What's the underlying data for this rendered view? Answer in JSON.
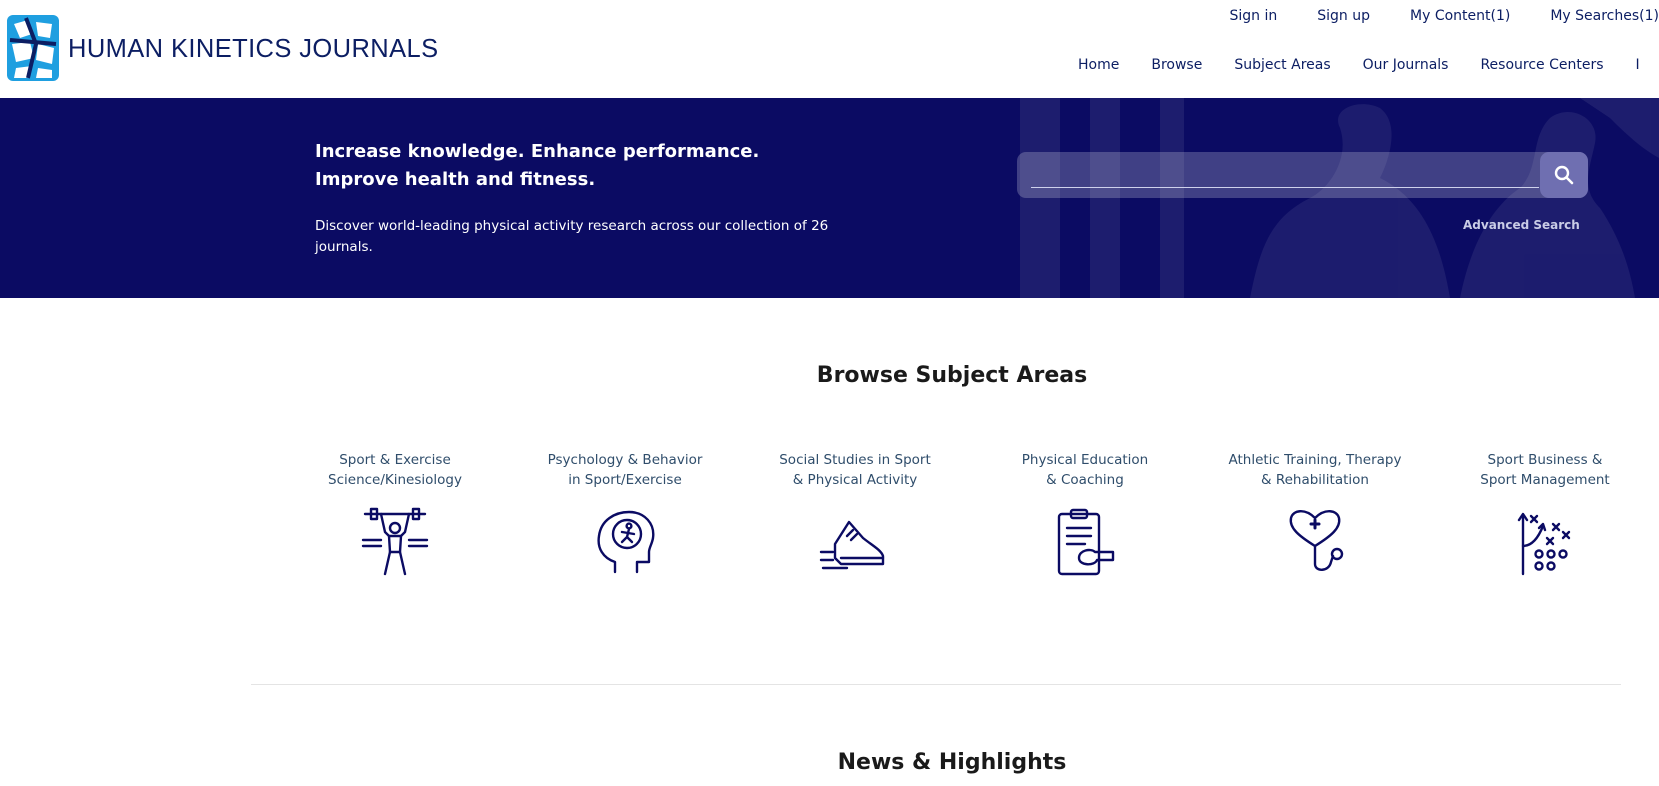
{
  "brand": {
    "name": "HUMAN KINETICS JOURNALS"
  },
  "utility_nav": [
    "Sign in",
    "Sign up",
    "My Content(1)",
    "My Searches(1)"
  ],
  "main_nav": [
    "Home",
    "Browse",
    "Subject Areas",
    "Our Journals",
    "Resource Centers",
    "I"
  ],
  "hero": {
    "headline_line1": "Increase knowledge. Enhance performance.",
    "headline_line2": "Improve health and fitness.",
    "subtext": "Discover world-leading physical activity research across our collection of 26 journals.",
    "search_placeholder": "",
    "advanced_search": "Advanced Search"
  },
  "subjects": {
    "title": "Browse Subject Areas",
    "items": [
      {
        "line1": "Sport & Exercise",
        "line2": "Science/Kinesiology",
        "icon": "weightlifter-icon"
      },
      {
        "line1": "Psychology & Behavior",
        "line2": "in Sport/Exercise",
        "icon": "head-brain-icon"
      },
      {
        "line1": "Social Studies in Sport",
        "line2": "& Physical Activity",
        "icon": "running-shoe-icon"
      },
      {
        "line1": "Physical Education",
        "line2": "& Coaching",
        "icon": "clipboard-whistle-icon"
      },
      {
        "line1": "Athletic Training, Therapy",
        "line2": "& Rehabilitation",
        "icon": "stethoscope-heart-icon"
      },
      {
        "line1": "Sport Business &",
        "line2": "Sport Management",
        "icon": "game-plan-icon"
      }
    ]
  },
  "news": {
    "title": "News & Highlights"
  },
  "colors": {
    "navy": "#0b0b63",
    "brand_text": "#0c1e63",
    "logo_blue": "#1f9fe0",
    "subject_text": "#2f4d6b"
  }
}
